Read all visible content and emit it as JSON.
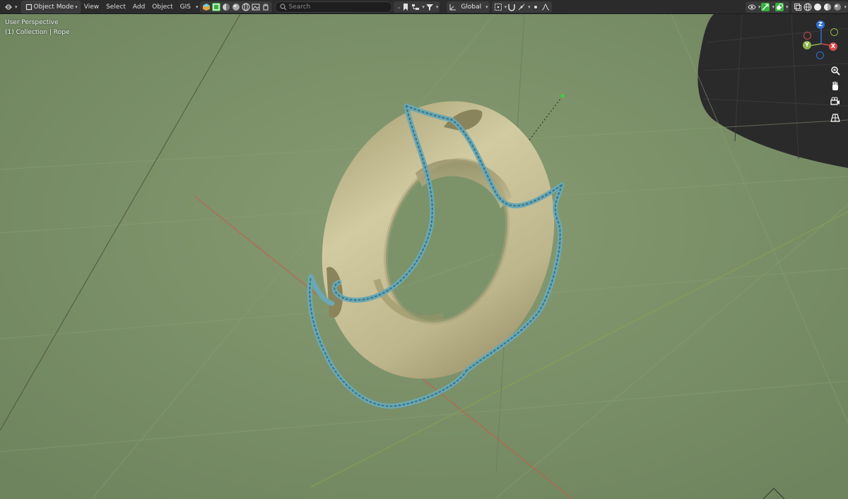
{
  "header": {
    "mode_label": "Object Mode",
    "menus": [
      "View",
      "Select",
      "Add",
      "Object",
      "GIS"
    ],
    "search_placeholder": "Search",
    "transform_orientation": "Global"
  },
  "viewport": {
    "perspective_label": "User Perspective",
    "collection_label": "(1) Collection | Rope"
  },
  "gizmo": {
    "z_label": "Z",
    "x_label": "X",
    "y_label": "Y"
  },
  "colors": {
    "rope": "#6aa8b4",
    "ring": "#c9c196",
    "background": "#7c9069",
    "axis_x": "#d24a4a",
    "axis_y": "#8db34a",
    "axis_z": "#2f6fd4"
  }
}
